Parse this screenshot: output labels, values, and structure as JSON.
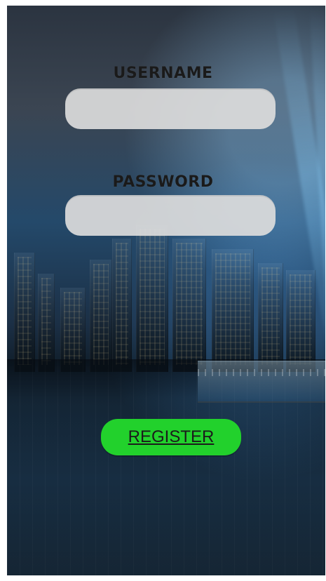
{
  "form": {
    "username_label": "USERNAME",
    "username_value": "",
    "username_placeholder": "",
    "password_label": "PASSWORD",
    "password_value": "",
    "password_placeholder": ""
  },
  "actions": {
    "register_label": "REGISTER"
  },
  "colors": {
    "register_button": "#22d12c",
    "field_background": "#dcdcdc",
    "label_text": "#1a1a1a"
  }
}
